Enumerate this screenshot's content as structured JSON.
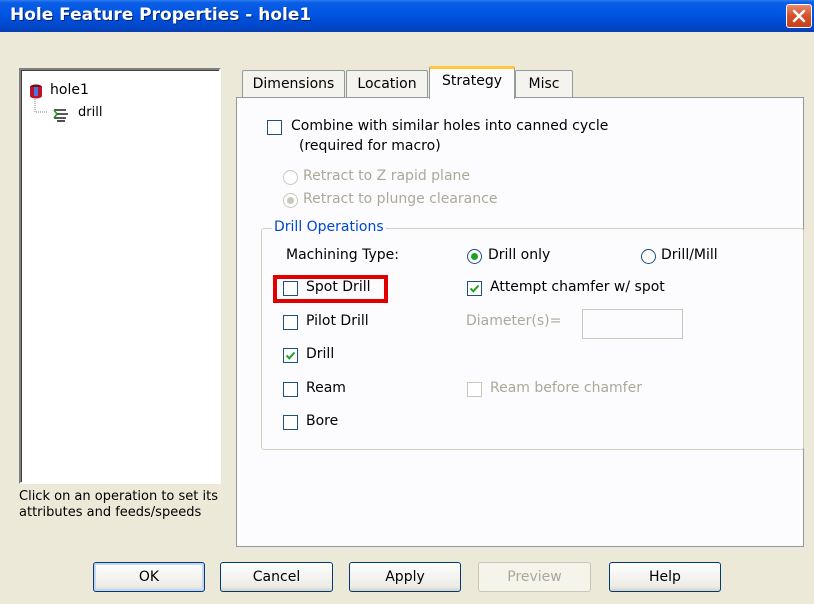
{
  "window": {
    "title": "Hole Feature Properties - hole1"
  },
  "tree": {
    "root_label": "hole1",
    "child_label": "drill",
    "hint": "Click on an operation to set its attributes and feeds/speeds"
  },
  "tabs": [
    {
      "label": "Dimensions"
    },
    {
      "label": "Location"
    },
    {
      "label": "Strategy"
    },
    {
      "label": "Misc"
    }
  ],
  "strategy": {
    "combine_label_line1": "Combine with similar holes into canned cycle",
    "combine_label_line2": "(required for macro)",
    "combine_checked": false,
    "retract_z_label": "Retract to Z rapid plane",
    "retract_plunge_label": "Retract to plunge clearance",
    "retract_selected": "plunge",
    "drill_ops": {
      "legend": "Drill Operations",
      "machining_type_label": "Machining Type:",
      "drill_only_label": "Drill only",
      "drill_mill_label": "Drill/Mill",
      "machining_type_selected": "drill_only",
      "spot_drill_label": "Spot Drill",
      "spot_drill_checked": false,
      "attempt_chamfer_label": "Attempt chamfer w/ spot",
      "attempt_chamfer_checked": true,
      "pilot_drill_label": "Pilot Drill",
      "pilot_drill_checked": false,
      "diameter_label": "Diameter(s)=",
      "diameter_value": "",
      "drill_label": "Drill",
      "drill_checked": true,
      "ream_label": "Ream",
      "ream_checked": false,
      "ream_before_chamfer_label": "Ream before chamfer",
      "ream_before_chamfer_checked": false,
      "bore_label": "Bore",
      "bore_checked": false
    }
  },
  "buttons": {
    "ok": "OK",
    "cancel": "Cancel",
    "apply": "Apply",
    "preview": "Preview",
    "help": "Help"
  },
  "colors": {
    "titlebar": "#0054e3",
    "highlight": "#e00000",
    "check": "#21a121",
    "group_legend": "#0046d5"
  }
}
